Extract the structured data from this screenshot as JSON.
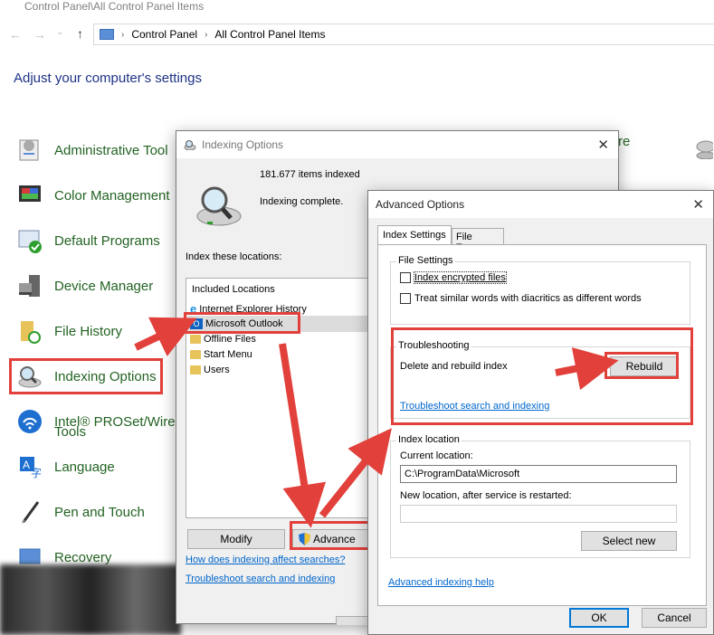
{
  "window": {
    "path_title": "Control Panel\\All Control Panel Items"
  },
  "breadcrumb": [
    "Control Panel",
    "All Control Panel Items"
  ],
  "heading": "Adjust your computer's settings",
  "cp_items": [
    {
      "label": "Administrative Tool"
    },
    {
      "label": "Color Management"
    },
    {
      "label": "Default Programs"
    },
    {
      "label": "Device Manager"
    },
    {
      "label": "File History"
    },
    {
      "label": "Indexing Options"
    },
    {
      "label": "Intel® PROSet/Wire"
    },
    {
      "label": "Tools"
    },
    {
      "label": "Language"
    },
    {
      "label": "Pen and Touch"
    },
    {
      "label": "Recovery"
    }
  ],
  "cp_partial": "re",
  "indexing": {
    "title": "Indexing Options",
    "items_indexed": "181.677 items indexed",
    "status": "Indexing complete.",
    "locations_label": "Index these locations:",
    "included_header": "Included Locations",
    "locations": [
      "Internet Explorer History",
      "Microsoft Outlook",
      "Offline Files",
      "Start Menu",
      "Users"
    ],
    "modify": "Modify",
    "advanced": "Advance",
    "link_affect": "How does indexing affect searches?",
    "link_troubleshoot": "Troubleshoot search and indexing"
  },
  "advanced": {
    "title": "Advanced Options",
    "tabs": [
      "Index Settings",
      "File Types"
    ],
    "file_settings": "File Settings",
    "opt_encrypted": "Index encrypted files",
    "opt_diacritics": "Treat similar words with diacritics as different words",
    "troubleshooting": "Troubleshooting",
    "delete_rebuild": "Delete and rebuild index",
    "rebuild": "Rebuild",
    "troubleshoot_link": "Troubleshoot search and indexing",
    "index_location": "Index location",
    "current_location_label": "Current location:",
    "current_location": "C:\\ProgramData\\Microsoft",
    "new_location_label": "New location, after service is restarted:",
    "new_location": "",
    "select_new": "Select new",
    "help_link": "Advanced indexing help",
    "ok": "OK",
    "cancel": "Cancel"
  },
  "colors": {
    "annotation_red": "#e2403b",
    "link": "#0066cc",
    "cp_green": "#236323"
  }
}
